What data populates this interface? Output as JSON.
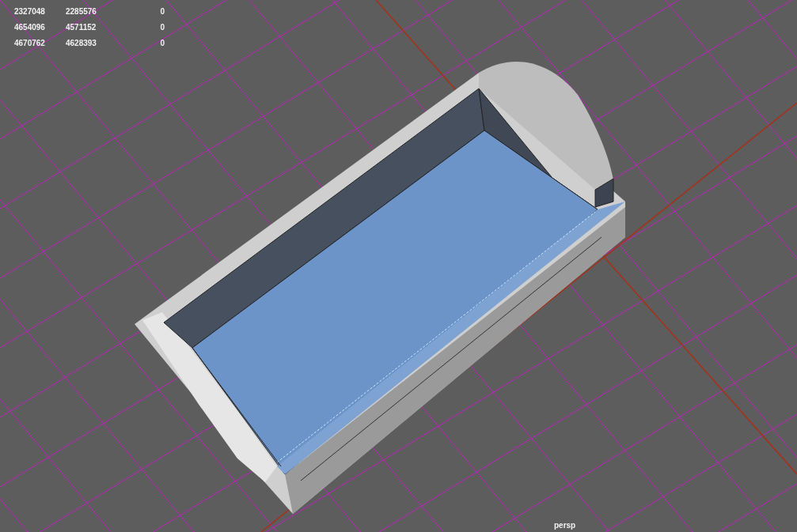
{
  "hud_stats": [
    {
      "cells": [
        "2327048",
        "2285576",
        "0"
      ]
    },
    {
      "cells": [
        "4654096",
        "4571152",
        "0"
      ]
    },
    {
      "cells": [
        "4670762",
        "4628393",
        "0"
      ]
    }
  ],
  "camera_label": "persp"
}
